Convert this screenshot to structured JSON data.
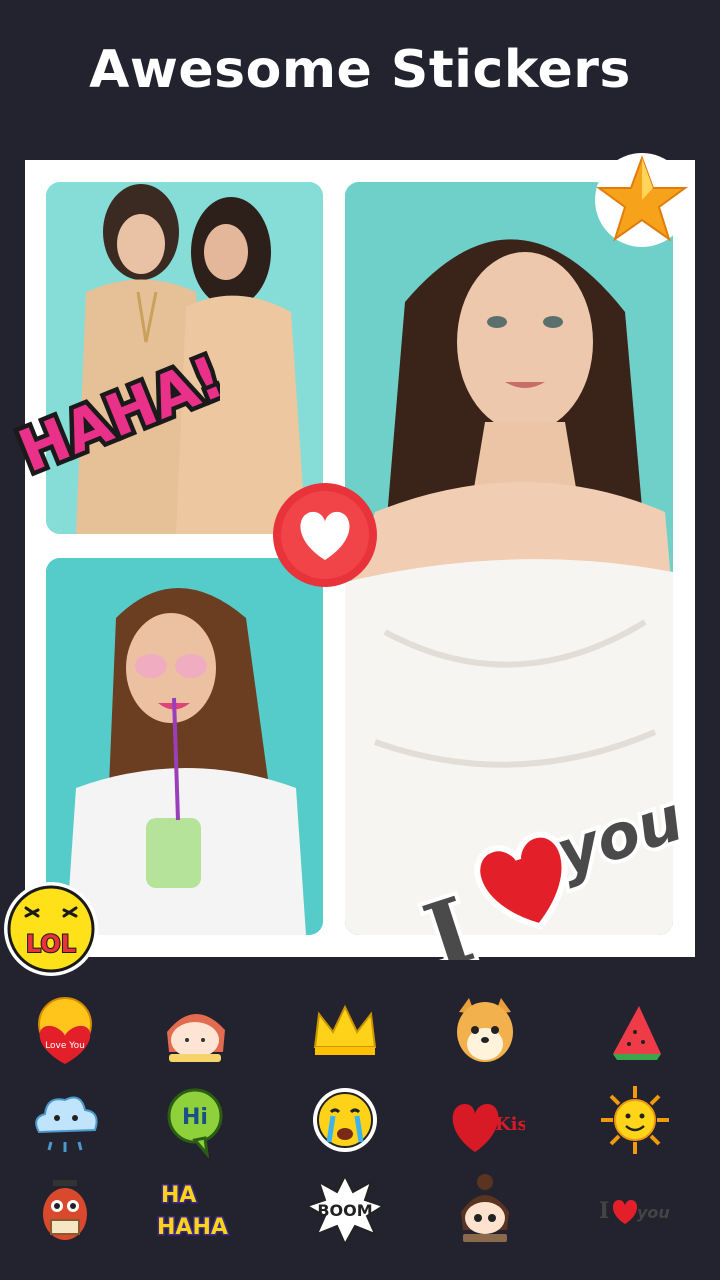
{
  "header": {
    "title": "Awesome Stickers"
  },
  "collage": {
    "stickers": {
      "haha": "HAHA!",
      "lol": "LOL",
      "i_love_you": {
        "i": "I",
        "you": "you"
      }
    }
  },
  "sticker_tray": {
    "items": [
      {
        "icon": "love-you-emoji-icon",
        "text": "Love You"
      },
      {
        "icon": "girl-face-icon"
      },
      {
        "icon": "crown-icon"
      },
      {
        "icon": "doge-icon"
      },
      {
        "icon": "watermelon-icon"
      },
      {
        "icon": "cloud-icon"
      },
      {
        "icon": "hi-bubble-icon",
        "text": "Hi"
      },
      {
        "icon": "crying-emoji-icon"
      },
      {
        "icon": "kiss-icon",
        "text": "Kiss"
      },
      {
        "icon": "sun-icon"
      },
      {
        "icon": "owl-icon"
      },
      {
        "icon": "haha-text-icon",
        "text1": "HA",
        "text2": "HAHA"
      },
      {
        "icon": "boom-icon",
        "text": "BOOM"
      },
      {
        "icon": "cute-girl-icon"
      },
      {
        "icon": "i-love-you-icon",
        "i": "I",
        "you": "you"
      }
    ]
  },
  "colors": {
    "background": "#23232f",
    "collage_frame": "#ffffff",
    "photo_bg": "#6fd3cf",
    "heart_red": "#e8333a",
    "star_orange": "#f7a21b",
    "haha_pink": "#e9318a"
  }
}
